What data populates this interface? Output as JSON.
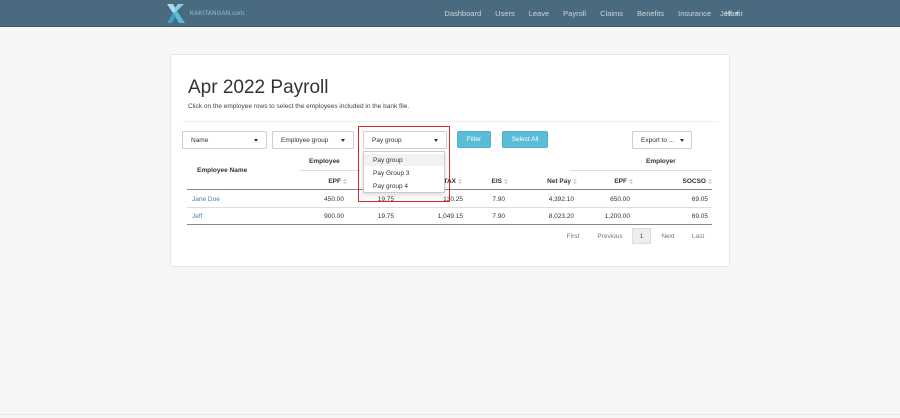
{
  "navbar": {
    "brand": "KAKITANGAN.com",
    "items": [
      "Dashboard",
      "Users",
      "Leave",
      "Payroll",
      "Claims",
      "Benefits",
      "Insurance",
      "Hadir"
    ],
    "user": "Jeff"
  },
  "page": {
    "title": "Apr 2022 Payroll",
    "subtitle": "Click on the employee rows to select the employees included in the bank file."
  },
  "filters": {
    "name": "Name",
    "employee_group": "Employee group",
    "pay_group": "Pay group",
    "filter_label": "Filter",
    "select_all_label": "Select All",
    "export_label": "Export to ..."
  },
  "pay_group_dropdown": {
    "options": [
      "Pay group",
      "Pay Group 3",
      "Pay group 4"
    ],
    "selected": "Pay group"
  },
  "table": {
    "group_headers": {
      "employee": "Employee",
      "employer": "Employer"
    },
    "columns": {
      "name": "Employee Name",
      "epf": "EPF",
      "socso": "SOCSO",
      "tax": "TAX",
      "eis": "EIS",
      "net_pay": "Net Pay",
      "employer_epf": "EPF",
      "employer_socso": "SOCSO"
    },
    "rows": [
      {
        "name": "Jane Doe",
        "epf": "450.00",
        "socso": "19.75",
        "tax": "130.25",
        "eis": "7.90",
        "net_pay": "4,392.10",
        "employer_epf": "650.00",
        "employer_socso": "69.05"
      },
      {
        "name": "Jeff",
        "epf": "900.00",
        "socso": "19.75",
        "tax": "1,049.15",
        "eis": "7.90",
        "net_pay": "8,023.20",
        "employer_epf": "1,200.00",
        "employer_socso": "69.05"
      }
    ]
  },
  "pagination": {
    "first": "First",
    "previous": "Previous",
    "current": "1",
    "next": "Next",
    "last": "Last"
  },
  "colors": {
    "navbar": "#4a6a80",
    "accent": "#5bbcd8",
    "link": "#4a7fa8",
    "highlight": "#d9272e"
  }
}
